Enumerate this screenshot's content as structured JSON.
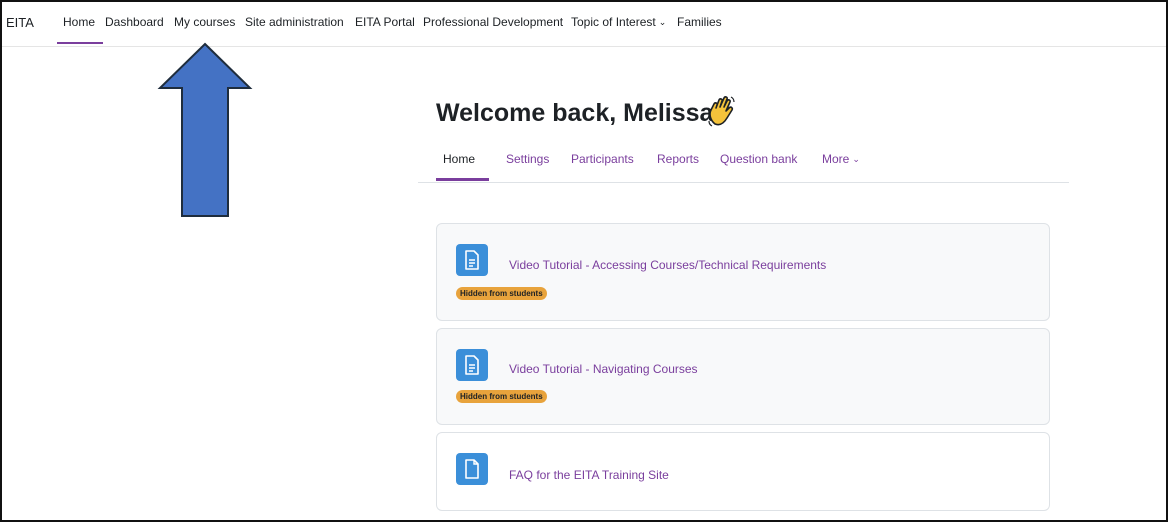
{
  "navbar": {
    "brand": "EITA",
    "items": [
      {
        "label": "Home"
      },
      {
        "label": "Dashboard"
      },
      {
        "label": "My courses"
      },
      {
        "label": "Site administration"
      },
      {
        "label": "EITA Portal"
      },
      {
        "label": "Professional Development"
      },
      {
        "label": "Topic of Interest"
      },
      {
        "label": "Families"
      }
    ]
  },
  "page": {
    "welcome": "Welcome back, Melissa!",
    "wave_icon": "waving-hand-icon"
  },
  "course_nav": {
    "items": [
      {
        "label": "Home"
      },
      {
        "label": "Settings"
      },
      {
        "label": "Participants"
      },
      {
        "label": "Reports"
      },
      {
        "label": "Question bank"
      },
      {
        "label": "More"
      }
    ]
  },
  "activities": [
    {
      "title": "Video Tutorial - Accessing Courses/Technical Requirements",
      "badge": "Hidden from students",
      "icon": "page-icon"
    },
    {
      "title": "Video Tutorial - Navigating Courses",
      "badge": "Hidden from students",
      "icon": "page-icon"
    },
    {
      "title": "FAQ for the EITA Training Site",
      "icon": "file-icon"
    }
  ],
  "colors": {
    "accent": "#7a3e9d",
    "icon_bg": "#3b8fd9",
    "badge_bg": "#e8a33c",
    "arrow_fill": "#4472c4"
  }
}
